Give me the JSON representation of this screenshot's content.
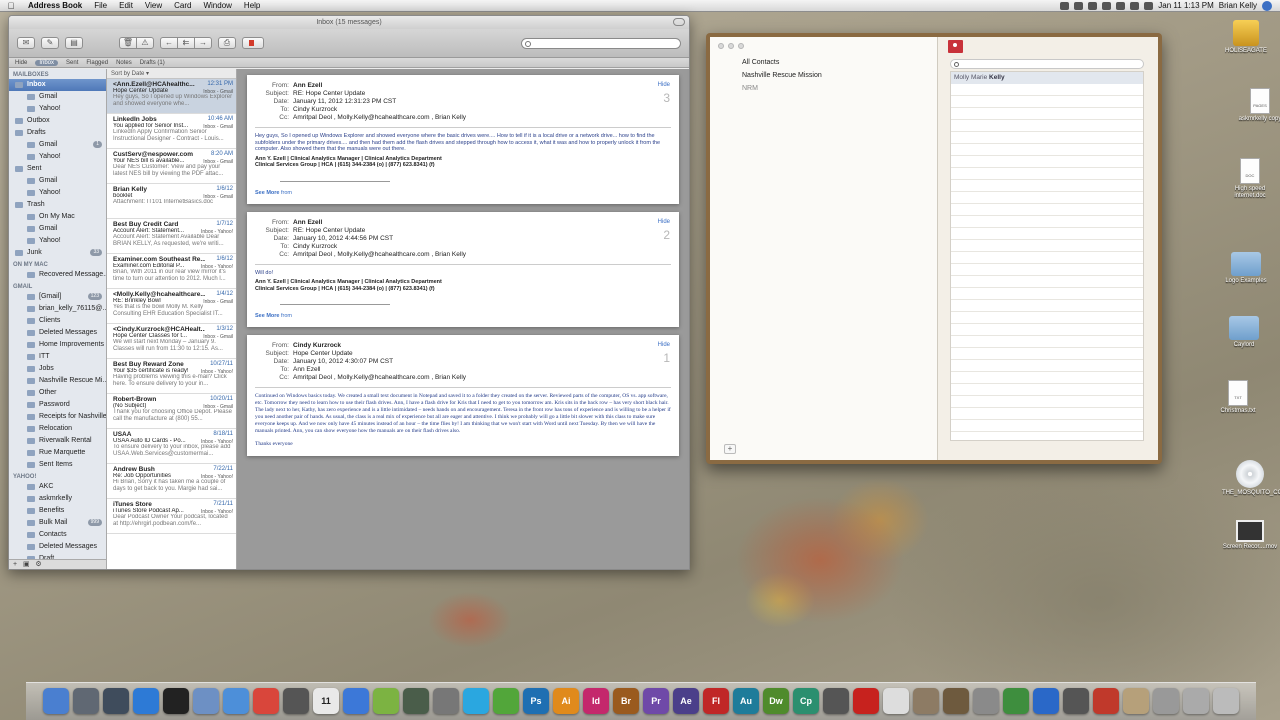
{
  "menubar": {
    "app_name": "Address Book",
    "menus": [
      "File",
      "Edit",
      "View",
      "Card",
      "Window",
      "Help"
    ],
    "clock": "Jan 11  1:13 PM",
    "user": "Brian Kelly"
  },
  "mail": {
    "window_title": "Inbox (15 messages)",
    "favorites": [
      "Hide",
      "Inbox",
      "Sent",
      "Flagged",
      "Notes",
      "Drafts (1)"
    ],
    "sort_label": "Sort by Date",
    "sidebar": {
      "sections": {
        "mailboxes": "MAILBOXES",
        "on_my_mac": "ON MY MAC",
        "gmail": "GMAIL",
        "yahoo": "YAHOO!"
      },
      "mailboxes": [
        {
          "label": "Inbox",
          "level": 0,
          "selected": true
        },
        {
          "label": "Gmail",
          "level": 1
        },
        {
          "label": "Yahoo!",
          "level": 1
        },
        {
          "label": "Outbox",
          "level": 0
        },
        {
          "label": "Drafts",
          "level": 0
        },
        {
          "label": "Gmail",
          "level": 1,
          "badge": "1"
        },
        {
          "label": "Yahoo!",
          "level": 1
        },
        {
          "label": "Sent",
          "level": 0
        },
        {
          "label": "Gmail",
          "level": 1
        },
        {
          "label": "Yahoo!",
          "level": 1
        },
        {
          "label": "Trash",
          "level": 0
        },
        {
          "label": "On My Mac",
          "level": 1
        },
        {
          "label": "Gmail",
          "level": 1
        },
        {
          "label": "Yahoo!",
          "level": 1
        },
        {
          "label": "Junk",
          "level": 0,
          "badge": "33"
        }
      ],
      "on_my_mac": [
        "Recovered Message..."
      ],
      "gmail": [
        {
          "label": "[Gmail]",
          "badge": "123"
        },
        {
          "label": "brian_kelly_76115@..."
        },
        {
          "label": "Clients"
        },
        {
          "label": "Deleted Messages"
        },
        {
          "label": "Home Improvements"
        },
        {
          "label": "ITT"
        },
        {
          "label": "Jobs"
        },
        {
          "label": "Nashville Rescue Mi..."
        },
        {
          "label": "Other"
        },
        {
          "label": "Password"
        },
        {
          "label": "Receipts for Nashville"
        },
        {
          "label": "Relocation"
        },
        {
          "label": "Riverwalk Rental"
        },
        {
          "label": "Rue Marquette"
        },
        {
          "label": "Sent Items"
        }
      ],
      "yahoo": [
        {
          "label": "AKC"
        },
        {
          "label": "askmrkelly"
        },
        {
          "label": "Benefits"
        },
        {
          "label": "Bulk Mail",
          "badge": "999"
        },
        {
          "label": "Contacts"
        },
        {
          "label": "Deleted Messages"
        },
        {
          "label": "Draft"
        }
      ]
    },
    "messages": [
      {
        "from": "<Ann.Ezell@HCAhealthc...",
        "date": "12:31 PM",
        "subject": "Hope Center Update",
        "mailbox": "Inbox - Gmail",
        "preview": "Hey guys, So I opened up Windows Explorer and showed everyone whe...",
        "selected": true
      },
      {
        "from": "LinkedIn Jobs",
        "date": "10:46 AM",
        "subject": "You applied for Senior Inst...",
        "mailbox": "Inbox - Gmail",
        "preview": "LinkedIn Apply Confirmation Senior Instructional Designer - Contract - Louis..."
      },
      {
        "from": "CustServ@nespower.com",
        "date": "8:20 AM",
        "subject": "Your NES bill is available...",
        "mailbox": "Inbox - Gmail",
        "preview": "Dear NES Customer: View and pay your latest NES bill by viewing the PDF attac..."
      },
      {
        "from": "Brian Kelly",
        "date": "1/6/12",
        "subject": "booklet",
        "mailbox": "Inbox - Gmail",
        "preview": "Attachment: IT101 InternetBasics.doc"
      },
      {
        "from": "Best Buy Credit Card",
        "date": "1/7/12",
        "subject": "Account Alert: Statement...",
        "mailbox": "Inbox - Yahoo!",
        "preview": "Account Alert: Statement Available Dear BRIAN KELLY, As requested, we're writi..."
      },
      {
        "from": "Examiner.com Southeast Re...",
        "date": "1/6/12",
        "subject": "Examiner.com Editorial P...",
        "mailbox": "Inbox - Yahoo!",
        "preview": "Brian, With 2011 in our rear view mirror it's time to turn our attention to 2012. Much l..."
      },
      {
        "from": "<Molly.Kelly@hcahealthcare...",
        "date": "1/4/12",
        "subject": "RE: Brinkley Bowl",
        "mailbox": "Inbox - Gmail",
        "preview": "Yes that is the bowl Molly M. Kelly Consulting EHR Education Specialist IT..."
      },
      {
        "from": "<Cindy.Kurzrock@HCAHealt...",
        "date": "1/3/12",
        "subject": "Hope Center Classes for t...",
        "mailbox": "Inbox - Gmail",
        "preview": "We will start next Monday – January 9. Classes will run from 11:30 to 12:15. As..."
      },
      {
        "from": "Best Buy Reward Zone",
        "date": "10/27/11",
        "subject": "Your $35 certificate is ready!",
        "mailbox": "Inbox - Yahoo!",
        "preview": "Having problems viewing this e-mail? Click here. To ensure delivery to your in..."
      },
      {
        "from": "Robert-Brown",
        "date": "10/20/11",
        "subject": "(No Subject)",
        "mailbox": "Inbox - Gmail",
        "preview": "Thank you for choosing Office Depot. Please call the manufacture at (800) 55..."
      },
      {
        "from": "USAA",
        "date": "8/18/11",
        "subject": "USAA Auto ID Cards - Po...",
        "mailbox": "Inbox - Yahoo!",
        "preview": "To ensure delivery to your inbox, please add USAA.Web.Services@customermai..."
      },
      {
        "from": "Andrew Bush",
        "date": "7/22/11",
        "subject": "Re: Job Opportunities",
        "mailbox": "Inbox - Yahoo!",
        "preview": "Hi Brian, Sorry it has taken me a couple of days to get back to you. Margie had sai..."
      },
      {
        "from": "iTunes Store",
        "date": "7/21/11",
        "subject": "iTunes Store Podcast Ap...",
        "mailbox": "Inbox - Yahoo!",
        "preview": "Dear Podcast Owner Your podcast, located at http://ehrgirl.podbean.com/fe..."
      }
    ],
    "thread": [
      {
        "from": "Ann Ezell",
        "subject": "RE: Hope Center Update",
        "date": "January 11, 2012 12:31:23 PM CST",
        "to": "Cindy Kurzrock",
        "cc": "Amritpal Deol ,  Molly.Kelly@hcahealthcare.com ,  Brian Kelly",
        "index": "3",
        "body": "Hey guys, So I opened up Windows Explorer and showed everyone where the basic drives were.... How to tell if it is a local drive or a network drive... how to find the subfolders under the primary drives.... and then had them add the flash drives and stepped through how to access it, what it was and how to properly unlock it from the computer. Also showed them that the manuals were out there.",
        "sig_name": "Ann Y. Ezell | Clinical Analytics Manager | Clinical Analytics Department",
        "sig_org": "Clinical Services Group | HCA | (615) 344-2384 (o) | (877) 623.8341) (f)",
        "see_more": "See More",
        "see_more_from": "from"
      },
      {
        "from": "Ann Ezell",
        "subject": "RE: Hope Center Update",
        "date": "January 10, 2012 4:44:56 PM CST",
        "to": "Cindy Kurzrock",
        "cc": "Amritpal Deol ,  Molly.Kelly@hcahealthcare.com ,  Brian Kelly",
        "index": "2",
        "body": "Will do!",
        "sig_name": "Ann Y. Ezell | Clinical Analytics Manager | Clinical Analytics Department",
        "sig_org": "Clinical Services Group | HCA | (615) 344-2384 (o) | (877) 623.8341) (f)",
        "see_more": "See More",
        "see_more_from": "from"
      },
      {
        "from": "Cindy Kurzrock",
        "subject": "Hope Center Update",
        "date": "January 10, 2012 4:30:07 PM CST",
        "to": "Ann Ezell",
        "cc": "Amritpal Deol ,  Molly.Kelly@hcahealthcare.com ,  Brian Kelly",
        "index": "1",
        "body": "Continued on Windows basics today. We created a small text document in Notepad and saved it to a folder they created on the server. Reviewed parts of the computer, OS vs. app software, etc. Tomorrow they need to learn how to use their flash drives. Ann, I have a flash drive for Kris that I need to get to you tomorrow am. Kris sits in the back row – has very short black hair. The lady next to her, Kathy, has zero experience and is a little intimidated – needs hands on and encouragement. Teresa in the front row has tons of experience and is willing to be a helper if you need another pair of hands. As usual, the class is a real mix of experience but all are eager and attentive. I think we probably will go a little bit slower with this class to make sure everyone keeps up. And we now only have 45 minutes instead of an hour – the time flies by! I am thinking that we won't start with Word until next Tuesday. By then we will have the manuals printed. Ann, you can show everyone how the manuals are on their flash drives also.",
        "closing": "Thanks everyone"
      }
    ],
    "labels": {
      "from": "From:",
      "subject": "Subject:",
      "date": "Date:",
      "to": "To:",
      "cc": "Cc:",
      "hide": "Hide"
    }
  },
  "address_book": {
    "groups": [
      "All Contacts",
      "Nashville Rescue Mission",
      "NRM"
    ],
    "contact": {
      "first": "Molly Marie",
      "last": "Kelly"
    },
    "add_label": "+"
  },
  "desktop_icons": [
    {
      "label": "HOLISEAGATE",
      "kind": "drive"
    },
    {
      "label": "askmrkelly copy",
      "kind": "doc",
      "doc_type": "PAGES"
    },
    {
      "label": "High speed internet.doc",
      "kind": "doc",
      "doc_type": "DOC"
    },
    {
      "label": "Logo Examples",
      "kind": "folder"
    },
    {
      "label": "Caylord",
      "kind": "folder"
    },
    {
      "label": "Christmas.txt",
      "kind": "doc",
      "doc_type": "TXT"
    },
    {
      "label": "THE_MOSQUITO_COAST",
      "kind": "disc"
    },
    {
      "label": "Screen Recor....mov",
      "kind": "movie"
    }
  ],
  "dock": [
    {
      "name": "finder",
      "label": "",
      "color": "#4a7fd0"
    },
    {
      "name": "launchpad",
      "label": "",
      "color": "#606873"
    },
    {
      "name": "mission-control",
      "label": "",
      "color": "#3f4c5c"
    },
    {
      "name": "app-store",
      "label": "",
      "color": "#2d7ad6"
    },
    {
      "name": "dashboard",
      "label": "",
      "color": "#222"
    },
    {
      "name": "preview",
      "label": "",
      "color": "#6d90c4"
    },
    {
      "name": "safari",
      "label": "",
      "color": "#4d8fd9"
    },
    {
      "name": "chrome",
      "label": "",
      "color": "#d9463b"
    },
    {
      "name": "facetime",
      "label": "",
      "color": "#555"
    },
    {
      "name": "ical",
      "label": "11",
      "color": "#e9e9e9"
    },
    {
      "name": "itunes",
      "label": "",
      "color": "#3c78d8"
    },
    {
      "name": "spotify",
      "label": "",
      "color": "#7cb342"
    },
    {
      "name": "time-machine",
      "label": "",
      "color": "#4a5d4a"
    },
    {
      "name": "system-prefs",
      "label": "",
      "color": "#777"
    },
    {
      "name": "twitter",
      "label": "",
      "color": "#2aa7e0"
    },
    {
      "name": "evernote",
      "label": "",
      "color": "#52a63a"
    },
    {
      "name": "photoshop",
      "label": "Ps",
      "color": "#1f6fb2"
    },
    {
      "name": "illustrator",
      "label": "Ai",
      "color": "#e08a1c"
    },
    {
      "name": "indesign",
      "label": "Id",
      "color": "#c4286c"
    },
    {
      "name": "bridge",
      "label": "Br",
      "color": "#9a5a1e"
    },
    {
      "name": "premiere",
      "label": "Pr",
      "color": "#6f49a8"
    },
    {
      "name": "after-effects",
      "label": "Ae",
      "color": "#4b3f8a"
    },
    {
      "name": "flash",
      "label": "Fl",
      "color": "#c02727"
    },
    {
      "name": "audition",
      "label": "Au",
      "color": "#1e7c9a"
    },
    {
      "name": "dreamweaver",
      "label": "Dw",
      "color": "#4f8b2c"
    },
    {
      "name": "captivate",
      "label": "Cp",
      "color": "#2b8f6f"
    },
    {
      "name": "calculator",
      "label": "",
      "color": "#555"
    },
    {
      "name": "acrobat",
      "label": "",
      "color": "#c7221e"
    },
    {
      "name": "textedit",
      "label": "",
      "color": "#ddd"
    },
    {
      "name": "image-capture",
      "label": "",
      "color": "#8d7b64"
    },
    {
      "name": "keynote",
      "label": "",
      "color": "#6e5a3e"
    },
    {
      "name": "script-editor",
      "label": "",
      "color": "#8a8a8a"
    },
    {
      "name": "numbers",
      "label": "",
      "color": "#3e8e3e"
    },
    {
      "name": "network",
      "label": "",
      "color": "#2a68c8"
    },
    {
      "name": "activity-monitor",
      "label": "",
      "color": "#555"
    },
    {
      "name": "photo-booth",
      "label": "",
      "color": "#c0392b"
    },
    {
      "name": "documents-stack",
      "label": "",
      "color": "#b6a07a"
    },
    {
      "name": "downloads-stack",
      "label": "",
      "color": "#999"
    },
    {
      "name": "applications-stack",
      "label": "",
      "color": "#aaa"
    },
    {
      "name": "trash",
      "label": "",
      "color": "#bbb"
    }
  ]
}
